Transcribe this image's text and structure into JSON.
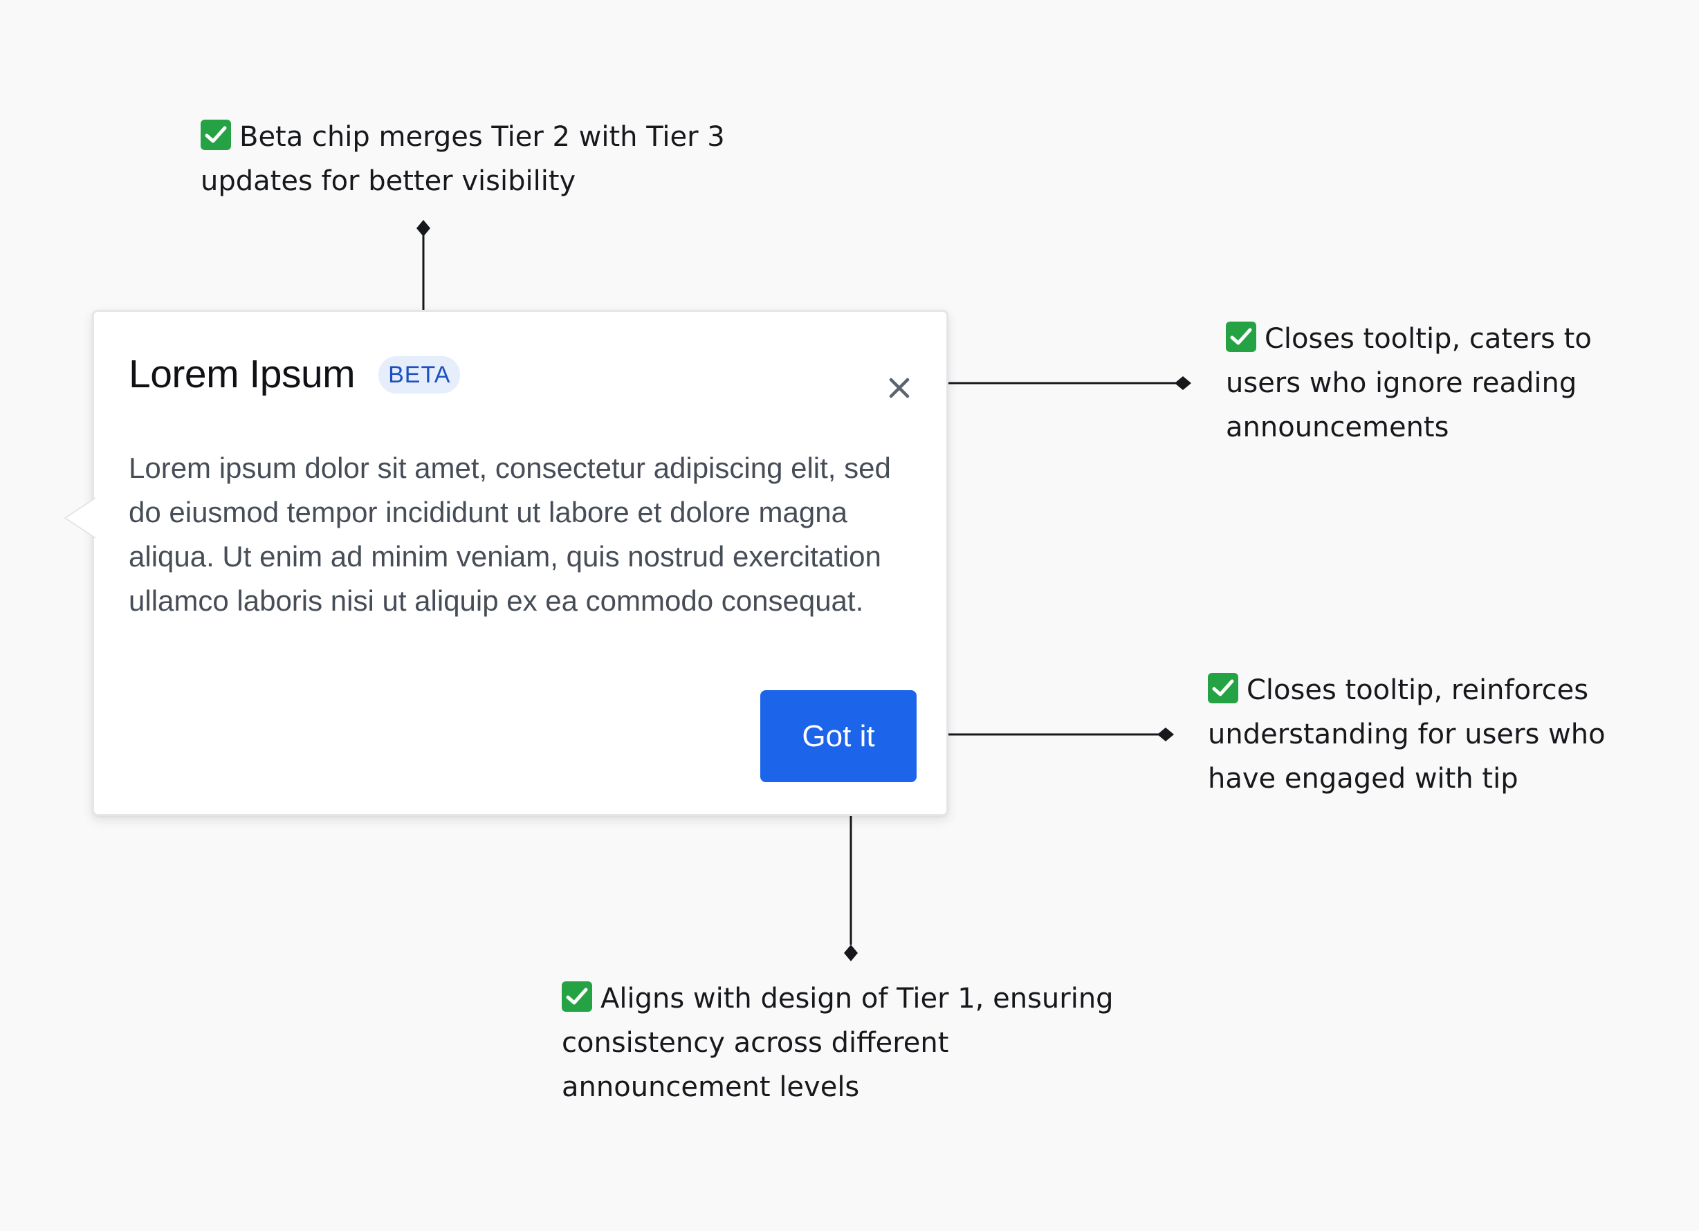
{
  "tooltip": {
    "title": "Lorem Ipsum",
    "badge": "BETA",
    "body": "Lorem ipsum dolor sit amet, consectetur adipiscing elit, sed do eiusmod tempor incididunt ut labore et dolore magna aliqua. Ut enim ad minim veniam, quis nostrud exercitation ullamco laboris nisi ut aliquip ex ea commodo consequat.",
    "primary_button": "Got it",
    "close_icon": "close-icon"
  },
  "annotations": {
    "beta_chip": "Beta chip merges Tier 2 with Tier 3 updates for better visibility",
    "close_button": "Closes tooltip, caters to users who ignore reading announcements",
    "got_it_button": "Closes tooltip, reinforces understanding for users who have engaged with tip",
    "button_design": "Aligns with design of Tier 1, ensuring consistency across different announcement levels"
  },
  "icons": {
    "annotation_marker": "check-icon"
  },
  "colors": {
    "background": "#f9f9f9",
    "primary": "#1c64ea",
    "badge_bg": "#e6eefb",
    "badge_text": "#1d4fc4",
    "check": "#25a244",
    "connector": "#16181c"
  }
}
